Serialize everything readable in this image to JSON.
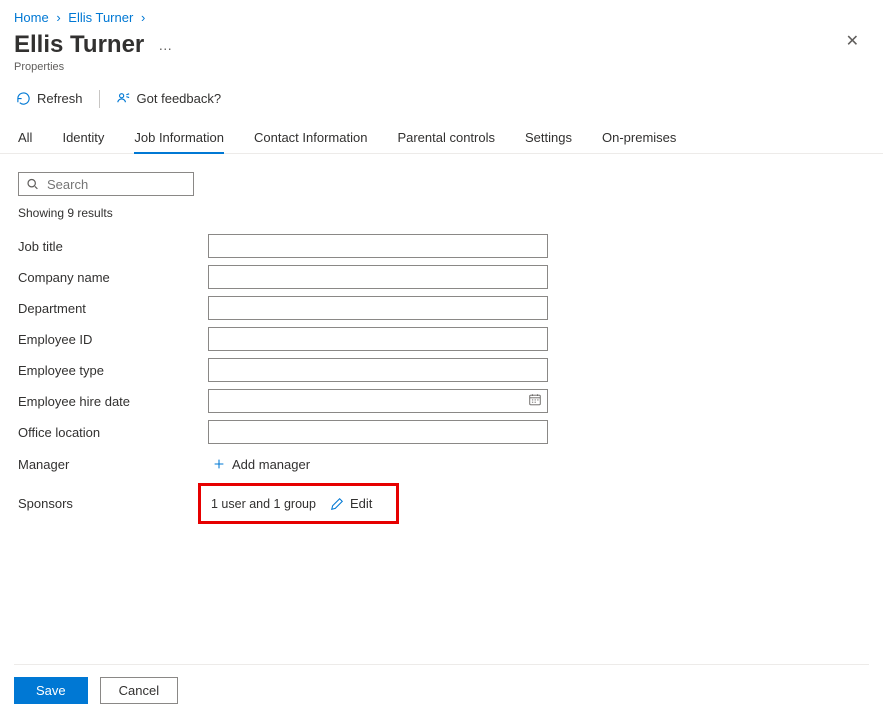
{
  "breadcrumb": {
    "home": "Home",
    "user": "Ellis Turner"
  },
  "header": {
    "title": "Ellis Turner",
    "subtitle": "Properties"
  },
  "toolbar": {
    "refresh": "Refresh",
    "feedback": "Got feedback?"
  },
  "tabs": {
    "all": "All",
    "identity": "Identity",
    "job_info": "Job Information",
    "contact": "Contact Information",
    "parental": "Parental controls",
    "settings": "Settings",
    "onprem": "On-premises"
  },
  "search": {
    "placeholder": "Search"
  },
  "results_text": "Showing 9 results",
  "fields": {
    "job_title": "Job title",
    "company_name": "Company name",
    "department": "Department",
    "employee_id": "Employee ID",
    "employee_type": "Employee type",
    "hire_date": "Employee hire date",
    "office_location": "Office location",
    "manager": "Manager",
    "sponsors": "Sponsors"
  },
  "manager_action": "Add manager",
  "sponsors_value": "1 user and 1 group",
  "sponsors_edit": "Edit",
  "footer": {
    "save": "Save",
    "cancel": "Cancel"
  }
}
